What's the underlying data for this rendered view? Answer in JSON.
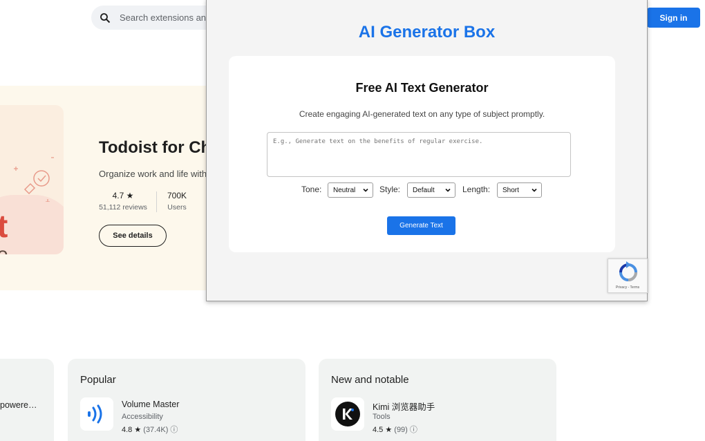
{
  "header": {
    "search_placeholder": "Search extensions and themes",
    "sign_in": "Sign in"
  },
  "hero": {
    "art_letter_1": "t",
    "art_letter_2": "e",
    "title": "Todoist for Chrome",
    "subtitle": "Organize work and life with Todoist",
    "rating": "4.7 ★",
    "reviews": "51,112 reviews",
    "users_value": "700K",
    "users_label": "Users",
    "details_button": "See details"
  },
  "popup": {
    "title": "AI Generator Box",
    "heading": "Free AI Text Generator",
    "description": "Create engaging AI-generated text on any type of subject promptly.",
    "prompt_placeholder": "E.g., Generate text on the benefits of regular exercise.",
    "tone_label": "Tone:",
    "tone_value": "Neutral",
    "style_label": "Style:",
    "style_value": "Default",
    "length_label": "Length:",
    "length_value": "Short",
    "generate_button": "Generate Text",
    "recaptcha_terms": "Privacy - Terms"
  },
  "cards": {
    "left_item_name": "powere…",
    "popular": {
      "title": "Popular",
      "item_name": "Volume Master",
      "item_category": "Accessibility",
      "item_rating": "4.8 ★",
      "item_count": "(37.4K)"
    },
    "new_notable": {
      "title": "New and notable",
      "item_name": "Kimi 浏览器助手",
      "item_category": "Tools",
      "item_rating": "4.5 ★",
      "item_count": "(99)"
    }
  },
  "colors": {
    "accent": "#1a73e8",
    "hero_bg": "#fdf8ec",
    "todoist_red": "#db4c3f",
    "card_bg": "#f1f3f2"
  }
}
